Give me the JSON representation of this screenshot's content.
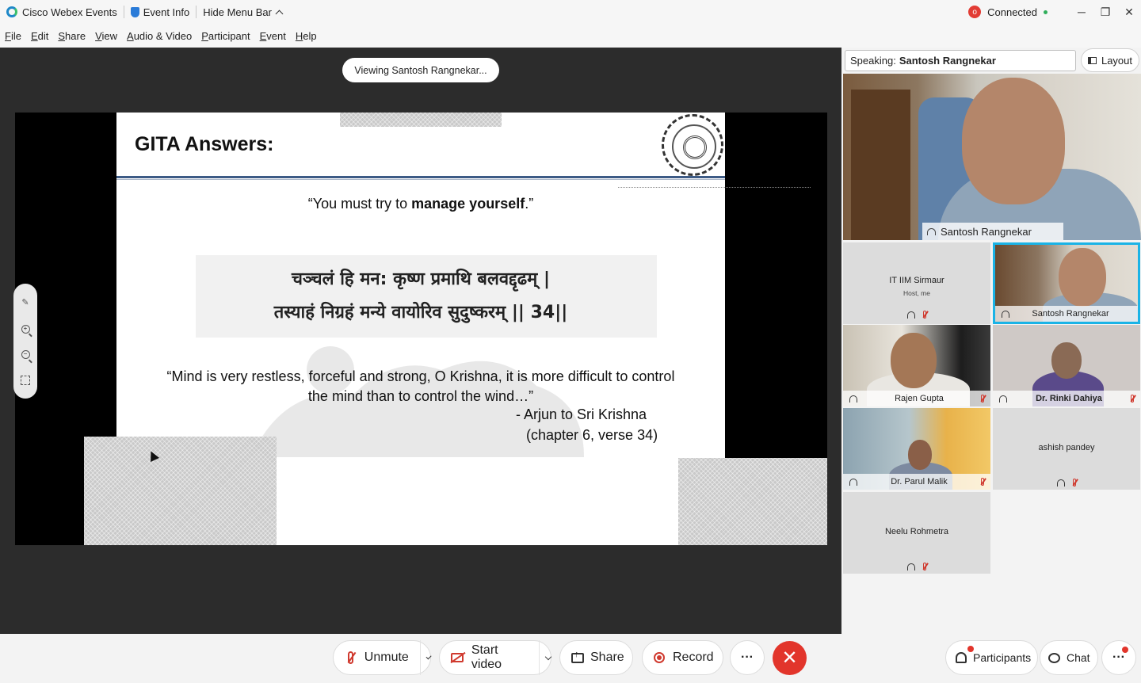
{
  "titlebar": {
    "app_name": "Cisco Webex Events",
    "event_info": "Event Info",
    "hide_menu": "Hide Menu Bar",
    "record_badge": "o",
    "connection": "Connected"
  },
  "window_controls": {
    "minimize": "─",
    "restore": "❐",
    "close": "✕"
  },
  "menu": [
    {
      "u": "F",
      "rest": "ile"
    },
    {
      "u": "E",
      "rest": "dit"
    },
    {
      "u": "S",
      "rest": "hare"
    },
    {
      "u": "V",
      "rest": "iew"
    },
    {
      "u": "A",
      "rest": "udio & Video"
    },
    {
      "u": "P",
      "rest": "articipant"
    },
    {
      "u": "E",
      "rest": "vent"
    },
    {
      "u": "H",
      "rest": "elp"
    }
  ],
  "stage": {
    "viewing": "Viewing Santosh Rangnekar..."
  },
  "slide": {
    "title": "GITA Answers:",
    "quote_pre": "“You must try to ",
    "quote_bold": "manage yourself",
    "quote_post": ".”",
    "sanskrit_line1": "चञ्चलं हि मन: कृष्ण प्रमाथि बलवद्दृढम् |",
    "sanskrit_line2": "तस्याहं निग्रहं मन्ये वायोरिव सुदुष्करम् || 34||",
    "quote2_line1": "“Mind is very restless, forceful and strong, O Krishna, it is more difficult to control",
    "quote2_line2": "the mind than to control the wind…”",
    "attribution1": "-   Arjun to Sri Krishna",
    "attribution2": "(chapter 6, verse 34)"
  },
  "panel": {
    "speaking_label": "Speaking:",
    "speaking_name": "Santosh Rangnekar",
    "layout_label": "Layout",
    "main_video_name": "Santosh Rangnekar"
  },
  "participants": [
    {
      "name": "IT IIM Sirmaur",
      "sub": "Host, me"
    },
    {
      "name": "Santosh Rangnekar"
    },
    {
      "name": "Rajen Gupta"
    },
    {
      "name": "Dr. Rinki Dahiya"
    },
    {
      "name": "Dr. Parul Malik"
    },
    {
      "name": "ashish pandey"
    },
    {
      "name": "Neelu Rohmetra"
    }
  ],
  "controls": {
    "unmute": "Unmute",
    "start_video": "Start video",
    "share": "Share",
    "record": "Record",
    "more": "···",
    "leave": "✕",
    "participants": "Participants",
    "chat": "Chat",
    "panel_more": "···"
  },
  "colors": {
    "accent_blue": "#1ab3e6",
    "danger_red": "#e2352b",
    "slide_rule": "#3d5b86",
    "stage_bg": "#2c2c2c"
  }
}
